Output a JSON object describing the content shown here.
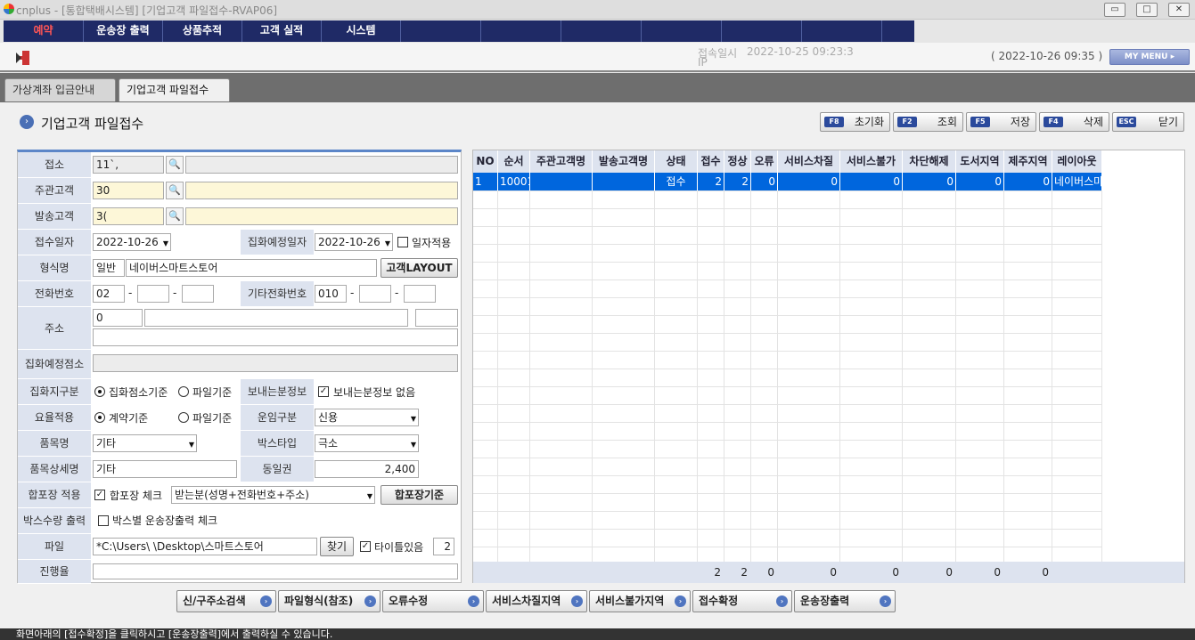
{
  "window": {
    "title": "cnplus - [통합택배시스템] [기업고객 파일접수-RVAP06]"
  },
  "menu": [
    "예약",
    "운송장 출력",
    "상품추적",
    "고객 실적",
    "시스템"
  ],
  "header": {
    "login_label": "접속일시",
    "login_value": "2022-10-25 09:23:3",
    "ip_label": "IP",
    "current_time": "( 2022-10-26 09:35 )",
    "mymenu": "MY MENU ▸"
  },
  "tabs": [
    "가상계좌 입금안내",
    "기업고객 파일접수"
  ],
  "page": {
    "title": "기업고객 파일접수"
  },
  "fkeys": [
    {
      "key": "F8",
      "label": "초기화"
    },
    {
      "key": "F2",
      "label": "조회"
    },
    {
      "key": "F5",
      "label": "저장"
    },
    {
      "key": "F4",
      "label": "삭제"
    },
    {
      "key": "ESC",
      "label": "닫기"
    }
  ],
  "form": {
    "branch_label": "접소",
    "branch_code": "11`,",
    "main_cust_label": "주관고객",
    "main_cust_code": "30",
    "sender_label": "발송고객",
    "sender_code": "3(",
    "receipt_date_label": "접수일자",
    "receipt_date": "2022-10-26",
    "pickup_date_label": "집화예정일자",
    "pickup_date": "2022-10-26",
    "date_apply_label": "일자적용",
    "format_label": "형식명",
    "format_code": "일반",
    "format_name": "네이버스마트스토어",
    "cust_layout_btn": "고객LAYOUT",
    "phone_label": "전화번호",
    "phone1": "02",
    "phone_dash": "-",
    "other_phone_label": "기타전화번호",
    "other_phone1": "010",
    "address_label": "주소",
    "address_zip": "0",
    "pickup_branch_label": "집화예정점소",
    "pickup_type_label": "집화지구분",
    "pickup_opt1": "집화점소기준",
    "pickup_opt2": "파일기준",
    "sender_info_label": "보내는분정보",
    "sender_info_opt": "보내는분정보 없음",
    "rate_label": "요율적용",
    "rate_opt1": "계약기준",
    "rate_opt2": "파일기준",
    "freight_label": "운임구분",
    "freight_value": "신용",
    "item_label": "품목명",
    "item_value": "기타",
    "box_type_label": "박스타입",
    "box_type_value": "극소",
    "item_detail_label": "품목상세명",
    "item_detail_value": "기타",
    "same_zone_label": "동일권",
    "same_zone_value": "2,400",
    "merge_label": "합포장 적용",
    "merge_check": "합포장 체크",
    "merge_option": "받는분(성명+전화번호+주소)",
    "merge_btn": "합포장기준",
    "box_qty_label": "박스수량 출력",
    "box_qty_check": "박스별 운송장출력 체크",
    "file_label": "파일",
    "file_path": "*C:\\Users\\          \\Desktop\\스마트스토어",
    "find_btn": "찾기",
    "title_row_label": "타이틀있음",
    "title_row_value": "2",
    "progress_label": "진행율",
    "progress": 0
  },
  "grid": {
    "columns": [
      "NO",
      "순서",
      "주관고객명",
      "발송고객명",
      "상태",
      "접수",
      "정상",
      "오류",
      "서비스차질",
      "서비스불가",
      "차단해제",
      "도서지역",
      "제주지역",
      "레이아웃"
    ],
    "rows": [
      [
        "1",
        "10001",
        "",
        "",
        "접수",
        "2",
        "2",
        "0",
        "0",
        "0",
        "0",
        "0",
        "0",
        "네이버스마"
      ]
    ],
    "footer": [
      "",
      "",
      "",
      "",
      "",
      "2",
      "2",
      "0",
      "0",
      "0",
      "0",
      "0",
      "0",
      ""
    ]
  },
  "bottom_buttons": [
    "신/구주소검색",
    "파일형식(참조)",
    "오류수정",
    "서비스차질지역",
    "서비스불가지역",
    "접수확정",
    "운송장출력"
  ],
  "status": "화면아래의 [접수확정]을 클릭하시고 [운송장출력]에서 출력하실 수 있습니다.",
  "colors": {
    "menu_bg": "#1f2a66",
    "accent": "#0066dd",
    "label_bg": "#dde3ef"
  }
}
